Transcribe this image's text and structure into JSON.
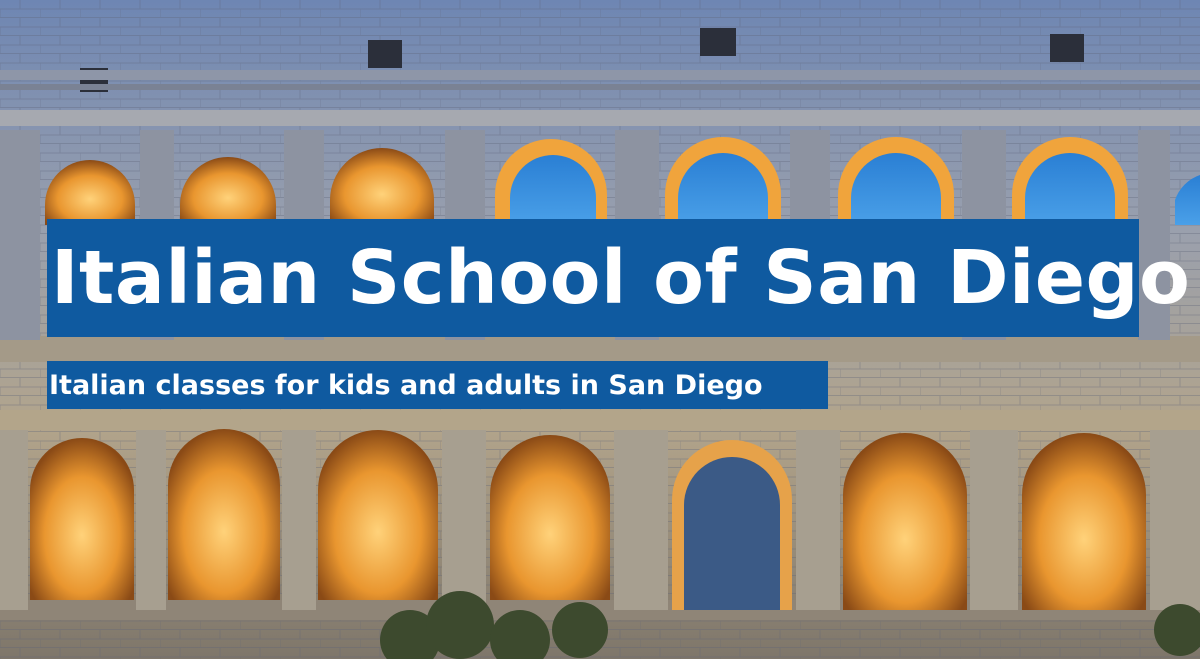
{
  "hero": {
    "title": "Italian School of San Diego",
    "subtitle": "Italian classes for kids and adults in San Diego",
    "background_image": "colosseum-photo"
  },
  "colors": {
    "band": "#0f5aa0",
    "text": "#ffffff",
    "arch_glow": "#f2a33a",
    "sky": "#2f86d6"
  }
}
